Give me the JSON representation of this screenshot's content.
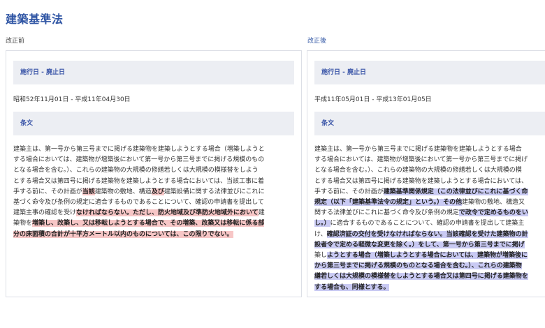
{
  "page": {
    "title": "建築基準法"
  },
  "columns": {
    "before_label": "改正前",
    "after_label": "改正後"
  },
  "before": {
    "enforce_heading": "施行日 - 廃止日",
    "date_range": "昭和52年11月01日 - 平成11年04月30日",
    "article_heading": "条文",
    "lines": [
      [
        {
          "t": "建築主は、第一号から第三号までに掲げる建築物を建築しようとする場合（増築しようと",
          "h": ""
        }
      ],
      [
        {
          "t": "する場合においては、建築物が増築後において第一号から第三号までに掲げる規模のもの",
          "h": ""
        }
      ],
      [
        {
          "t": "となる場合を含む。）、これらの建築物の大規模の修繕若しくは大規模の模様替をしよう",
          "h": ""
        }
      ],
      [
        {
          "t": "とする場合又は第四号に掲げる建築物を建築しようとする場合においては、当該工事に着",
          "h": ""
        }
      ],
      [
        {
          "t": "手する前に、その計画が",
          "h": ""
        },
        {
          "t": "当該",
          "h": "del"
        },
        {
          "t": "建築物の敷地、構造",
          "h": ""
        },
        {
          "t": "及び",
          "h": "del"
        },
        {
          "t": "建築設備に関する法律並びにこれに",
          "h": ""
        }
      ],
      [
        {
          "t": "基づく命令及び条例の規定に適合するものであることについて、確認の申請書を提出して",
          "h": ""
        }
      ],
      [
        {
          "t": "建築主事の確認を受け",
          "h": ""
        },
        {
          "t": "なければならない。ただし、防火地域及び準防火地域外において",
          "h": "del"
        },
        {
          "t": "建",
          "h": ""
        }
      ],
      [
        {
          "t": "築物を",
          "h": ""
        },
        {
          "t": "増築し、改築し、又は移転しようとする場合で、その増築、改築又は移転に係る部",
          "h": "del"
        }
      ],
      [
        {
          "t": "分の床面積の合計が十平方メートル以内のものについては、この限りでない。",
          "h": "del"
        }
      ]
    ]
  },
  "after": {
    "enforce_heading": "施行日 - 廃止日",
    "date_range": "平成11年05月01日 - 平成13年01月05日",
    "article_heading": "条文",
    "lines": [
      [
        {
          "t": "建築主は、第一号から第三号までに掲げる建築物を建築しようとする場合",
          "h": ""
        }
      ],
      [
        {
          "t": "する場合においては、建築物が増築後において第一号から第三号までに掲げ",
          "h": ""
        }
      ],
      [
        {
          "t": "となる場合を含む。）、これらの建築物の大規模の修繕若しくは大規模の模",
          "h": ""
        }
      ],
      [
        {
          "t": "とする場合又は第四号に掲げる建築物を建築しようとする場合においては、",
          "h": ""
        }
      ],
      [
        {
          "t": "手する前に、その計画が",
          "h": ""
        },
        {
          "t": "建築基準関係規定（この法律並びにこれに基づく命",
          "h": "ins"
        }
      ],
      [
        {
          "t": "規定（以下「建築基準法令の規定」という。）その他",
          "h": "ins"
        },
        {
          "t": "建築物の敷地、構造又",
          "h": ""
        }
      ],
      [
        {
          "t": "関する法律並びにこれに基づく命令及び条例の規定",
          "h": ""
        },
        {
          "t": "で政令で定めるものをい",
          "h": "ins"
        }
      ],
      [
        {
          "t": "し。）",
          "h": "ins"
        },
        {
          "t": "に適合するものであることについて、確認の申請書を提出して建築主",
          "h": ""
        }
      ],
      [
        {
          "t": "け、",
          "h": ""
        },
        {
          "t": "確認済証の交付を受けなければならない。当該確認を受けた建築物の計",
          "h": "ins"
        }
      ],
      [
        {
          "t": "設者令で定める軽微な変更を除く。）をして、第一号から第三号までに掲げ",
          "h": "ins"
        }
      ],
      [
        {
          "t": "築し",
          "h": ""
        },
        {
          "t": "ようとする場合（増築しようとする場合においては、建築物が増築後に",
          "h": "ins"
        }
      ],
      [
        {
          "t": "から第三号までに掲げる規模のものとなる場合を含む。）、これらの建築物",
          "h": "ins"
        }
      ],
      [
        {
          "t": "繕若しくは大規模の模様替をしようとする場合又は第四号に掲げる建築物を",
          "h": "ins"
        }
      ],
      [
        {
          "t": "する場合も、同様とする。",
          "h": "ins"
        }
      ]
    ]
  }
}
